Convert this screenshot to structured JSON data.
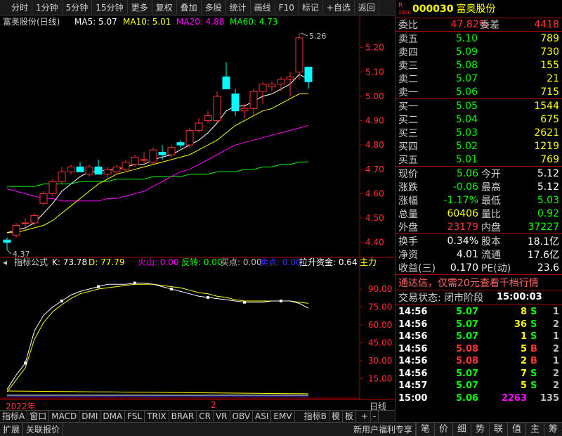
{
  "toolbar": {
    "items": [
      "分时",
      "1分钟",
      "5分钟",
      "15分钟",
      "更多",
      "复权",
      "叠加",
      "多股",
      "统计",
      "画线",
      "F10",
      "标记",
      "+自选",
      "返回"
    ]
  },
  "chart": {
    "title": "富奥股份(日线)",
    "ma": [
      {
        "label": "MA5: 5.07",
        "color": "#ffffff"
      },
      {
        "label": "MA10: 5.01",
        "color": "#ffff00"
      },
      {
        "label": "MA20: 4.88",
        "color": "#ff00ff"
      },
      {
        "label": "MA60: 4.73",
        "color": "#00ff00"
      }
    ],
    "high_label": "5.26",
    "low_label": "4.37",
    "price_axis": [
      "5.20",
      "5.10",
      "5.00",
      "4.90",
      "4.80",
      "4.70",
      "4.60",
      "4.50",
      "4.40"
    ],
    "indicator_title": "指标公式",
    "indicators": [
      {
        "label": "K: 73.78",
        "color": "#ffffff"
      },
      {
        "label": "D: 77.79",
        "color": "#ffff00"
      },
      {
        "label": "火山: 0.00",
        "color": "#ff00ff"
      },
      {
        "label": "反转: 0.00",
        "color": "#00ff00"
      },
      {
        "label": "买点: 0.00",
        "color": "#c0c0c0"
      },
      {
        "label": "卖点: 0.00",
        "color": "#3333ff"
      },
      {
        "label": "拉升资金: 0.64",
        "color": "#ffffff"
      },
      {
        "label": "主力",
        "color": "#ffff00"
      }
    ],
    "ind_axis": [
      "90.00",
      "75.00",
      "60.00",
      "45.00",
      "30.00",
      "15.00"
    ],
    "date_left": "2022年",
    "date_mid": "2",
    "period_label": "日线"
  },
  "chart_data": {
    "type": "candlestick",
    "ohlc": [
      [
        4.41,
        4.42,
        4.37,
        4.4
      ],
      [
        4.43,
        4.48,
        4.42,
        4.47
      ],
      [
        4.48,
        4.5,
        4.45,
        4.48
      ],
      [
        4.48,
        4.52,
        4.47,
        4.51
      ],
      [
        4.56,
        4.61,
        4.55,
        4.6
      ],
      [
        4.6,
        4.66,
        4.59,
        4.65
      ],
      [
        4.65,
        4.71,
        4.64,
        4.69
      ],
      [
        4.69,
        4.72,
        4.68,
        4.71
      ],
      [
        4.71,
        4.73,
        4.69,
        4.69
      ],
      [
        4.68,
        4.72,
        4.67,
        4.71
      ],
      [
        4.71,
        4.74,
        4.68,
        4.68
      ],
      [
        4.68,
        4.71,
        4.66,
        4.7
      ],
      [
        4.69,
        4.72,
        4.68,
        4.71
      ],
      [
        4.7,
        4.74,
        4.69,
        4.73
      ],
      [
        4.72,
        4.76,
        4.71,
        4.75
      ],
      [
        4.74,
        4.77,
        4.72,
        4.74
      ],
      [
        4.73,
        4.79,
        4.72,
        4.78
      ],
      [
        4.77,
        4.8,
        4.74,
        4.76
      ],
      [
        4.76,
        4.8,
        4.75,
        4.79
      ],
      [
        4.81,
        4.82,
        4.79,
        4.8
      ],
      [
        4.8,
        4.87,
        4.79,
        4.86
      ],
      [
        4.86,
        4.91,
        4.85,
        4.89
      ],
      [
        4.9,
        4.94,
        4.89,
        4.92
      ],
      [
        4.9,
        5.02,
        4.89,
        5.0
      ],
      [
        5.08,
        5.14,
        5.04,
        5.03
      ],
      [
        5.01,
        5.03,
        4.92,
        4.94
      ],
      [
        4.94,
        4.97,
        4.91,
        4.95
      ],
      [
        4.95,
        5.03,
        4.92,
        5.02
      ],
      [
        5.02,
        5.06,
        4.97,
        5.05
      ],
      [
        5.04,
        5.06,
        5.02,
        5.05
      ],
      [
        5.05,
        5.08,
        5.02,
        5.07
      ],
      [
        5.07,
        5.1,
        5.0,
        5.08
      ],
      [
        5.1,
        5.26,
        5.07,
        5.24
      ],
      [
        5.12,
        5.12,
        5.03,
        5.06
      ]
    ],
    "ma5": [
      4.44,
      4.45,
      4.46,
      4.48,
      4.52,
      4.56,
      4.61,
      4.64,
      4.67,
      4.69,
      4.69,
      4.7,
      4.7,
      4.71,
      4.72,
      4.72,
      4.74,
      4.75,
      4.76,
      4.78,
      4.8,
      4.82,
      4.85,
      4.89,
      4.94,
      4.96,
      4.96,
      4.98,
      5.0,
      5.01,
      5.03,
      5.05,
      5.09,
      5.07
    ],
    "ma10": [
      4.44,
      4.44,
      4.45,
      4.46,
      4.47,
      4.49,
      4.52,
      4.55,
      4.58,
      4.61,
      4.64,
      4.66,
      4.68,
      4.69,
      4.7,
      4.71,
      4.72,
      4.73,
      4.74,
      4.75,
      4.76,
      4.78,
      4.8,
      4.82,
      4.85,
      4.88,
      4.9,
      4.92,
      4.94,
      4.95,
      4.97,
      4.99,
      5.01,
      5.01
    ],
    "ma20": [
      4.62,
      4.61,
      4.6,
      4.59,
      4.58,
      4.58,
      4.57,
      4.57,
      4.57,
      4.57,
      4.57,
      4.58,
      4.58,
      4.59,
      4.6,
      4.61,
      4.63,
      4.65,
      4.67,
      4.69,
      4.7,
      4.72,
      4.74,
      4.76,
      4.78,
      4.8,
      4.81,
      4.82,
      4.83,
      4.84,
      4.85,
      4.86,
      4.87,
      4.88
    ],
    "ma60": [
      4.63,
      4.63,
      4.63,
      4.63,
      4.64,
      4.64,
      4.64,
      4.64,
      4.65,
      4.65,
      4.65,
      4.65,
      4.66,
      4.66,
      4.66,
      4.66,
      4.67,
      4.67,
      4.67,
      4.67,
      4.68,
      4.68,
      4.68,
      4.69,
      4.69,
      4.69,
      4.7,
      4.7,
      4.71,
      4.71,
      4.72,
      4.72,
      4.73,
      4.73
    ],
    "k": [
      6,
      18,
      28,
      55,
      68,
      75,
      80,
      85,
      88,
      90,
      92,
      94,
      94,
      94,
      95,
      95,
      94,
      92,
      90,
      88,
      86,
      84,
      83,
      82,
      81,
      80,
      79,
      79,
      79,
      80,
      80,
      80,
      78,
      74
    ],
    "d": [
      4,
      14,
      24,
      48,
      62,
      71,
      77,
      82,
      86,
      88,
      90,
      91,
      92,
      93,
      94,
      94,
      94,
      93,
      92,
      91,
      89,
      87,
      86,
      84,
      83,
      81,
      80,
      80,
      80,
      80,
      80,
      80,
      79,
      78
    ],
    "ind_ylim": [
      0,
      100
    ],
    "price_ylim": [
      4.35,
      5.28
    ]
  },
  "quote": {
    "badge_top": "R",
    "badge_bottom": "1000",
    "code": "000030",
    "name": "富奥股份",
    "weibi_label": "委比",
    "weibi": "47.82%",
    "weicha_label": "委差",
    "weicha": "4418",
    "asks": [
      {
        "label": "卖五",
        "price": "5.10",
        "vol": "789"
      },
      {
        "label": "卖四",
        "price": "5.09",
        "vol": "730"
      },
      {
        "label": "卖三",
        "price": "5.08",
        "vol": "155"
      },
      {
        "label": "卖二",
        "price": "5.07",
        "vol": "21"
      },
      {
        "label": "卖一",
        "price": "5.06",
        "vol": "715"
      }
    ],
    "bids": [
      {
        "label": "买一",
        "price": "5.05",
        "vol": "1544"
      },
      {
        "label": "买二",
        "price": "5.04",
        "vol": "675"
      },
      {
        "label": "买三",
        "price": "5.03",
        "vol": "2621"
      },
      {
        "label": "买四",
        "price": "5.02",
        "vol": "1219"
      },
      {
        "label": "买五",
        "price": "5.01",
        "vol": "769"
      }
    ],
    "stats": [
      {
        "l1": "现价",
        "v1": "5.06",
        "c1": "green",
        "l2": "今开",
        "v2": "5.12",
        "c2": "white"
      },
      {
        "l1": "涨跌",
        "v1": "-0.06",
        "c1": "green",
        "l2": "最高",
        "v2": "5.12",
        "c2": "white"
      },
      {
        "l1": "涨幅",
        "v1": "-1.17%",
        "c1": "green",
        "l2": "最低",
        "v2": "5.03",
        "c2": "green"
      },
      {
        "l1": "总量",
        "v1": "60406",
        "c1": "yellow",
        "l2": "量比",
        "v2": "0.92",
        "c2": "green"
      },
      {
        "l1": "外盘",
        "v1": "23179",
        "c1": "red",
        "l2": "内盘",
        "v2": "37227",
        "c2": "green"
      }
    ],
    "stats2": [
      {
        "l1": "换手",
        "v1": "0.34%",
        "l2": "股本",
        "v2": "18.1亿"
      },
      {
        "l1": "净资",
        "v1": "4.01",
        "l2": "流通",
        "v2": "17.6亿"
      },
      {
        "l1": "收益(三)",
        "v1": "0.170",
        "l2": "PE(动)",
        "v2": "23.6"
      }
    ],
    "ad": "通达信，仅需20元查看千档行情",
    "trade_state_label": "交易状态: 闭市阶段",
    "trade_time": "15:00:03",
    "ticks": [
      {
        "t": "14:56",
        "p": "5.07",
        "v": "8",
        "s": "S",
        "n": "1"
      },
      {
        "t": "14:56",
        "p": "5.07",
        "v": "36",
        "s": "S",
        "n": "2"
      },
      {
        "t": "14:56",
        "p": "5.07",
        "v": "1",
        "s": "S",
        "n": "1"
      },
      {
        "t": "14:56",
        "p": "5.08",
        "v": "5",
        "s": "B",
        "n": "2"
      },
      {
        "t": "14:56",
        "p": "5.08",
        "v": "2",
        "s": "B",
        "n": "1"
      },
      {
        "t": "14:56",
        "p": "5.07",
        "v": "7",
        "s": "S",
        "n": "2"
      },
      {
        "t": "14:57",
        "p": "5.07",
        "v": "5",
        "s": "S",
        "n": "2"
      },
      {
        "t": "15:00",
        "p": "5.06",
        "v": "2263",
        "s": "",
        "n": "135"
      }
    ]
  },
  "bottom_tabs": [
    "指标A",
    "窗口",
    "MACD",
    "DMI",
    "DMA",
    "FSL",
    "TRIX",
    "BRAR",
    "CR",
    "VR",
    "OBV",
    "ASI",
    "EMV",
    "指标B",
    "模",
    "板",
    "+",
    "-"
  ],
  "status_bar": {
    "left": [
      "扩展",
      "关联报价"
    ],
    "mid": "新用户福利专享",
    "right": [
      "笔",
      "价",
      "细",
      "势",
      "联",
      "值",
      "主",
      "筹"
    ]
  }
}
